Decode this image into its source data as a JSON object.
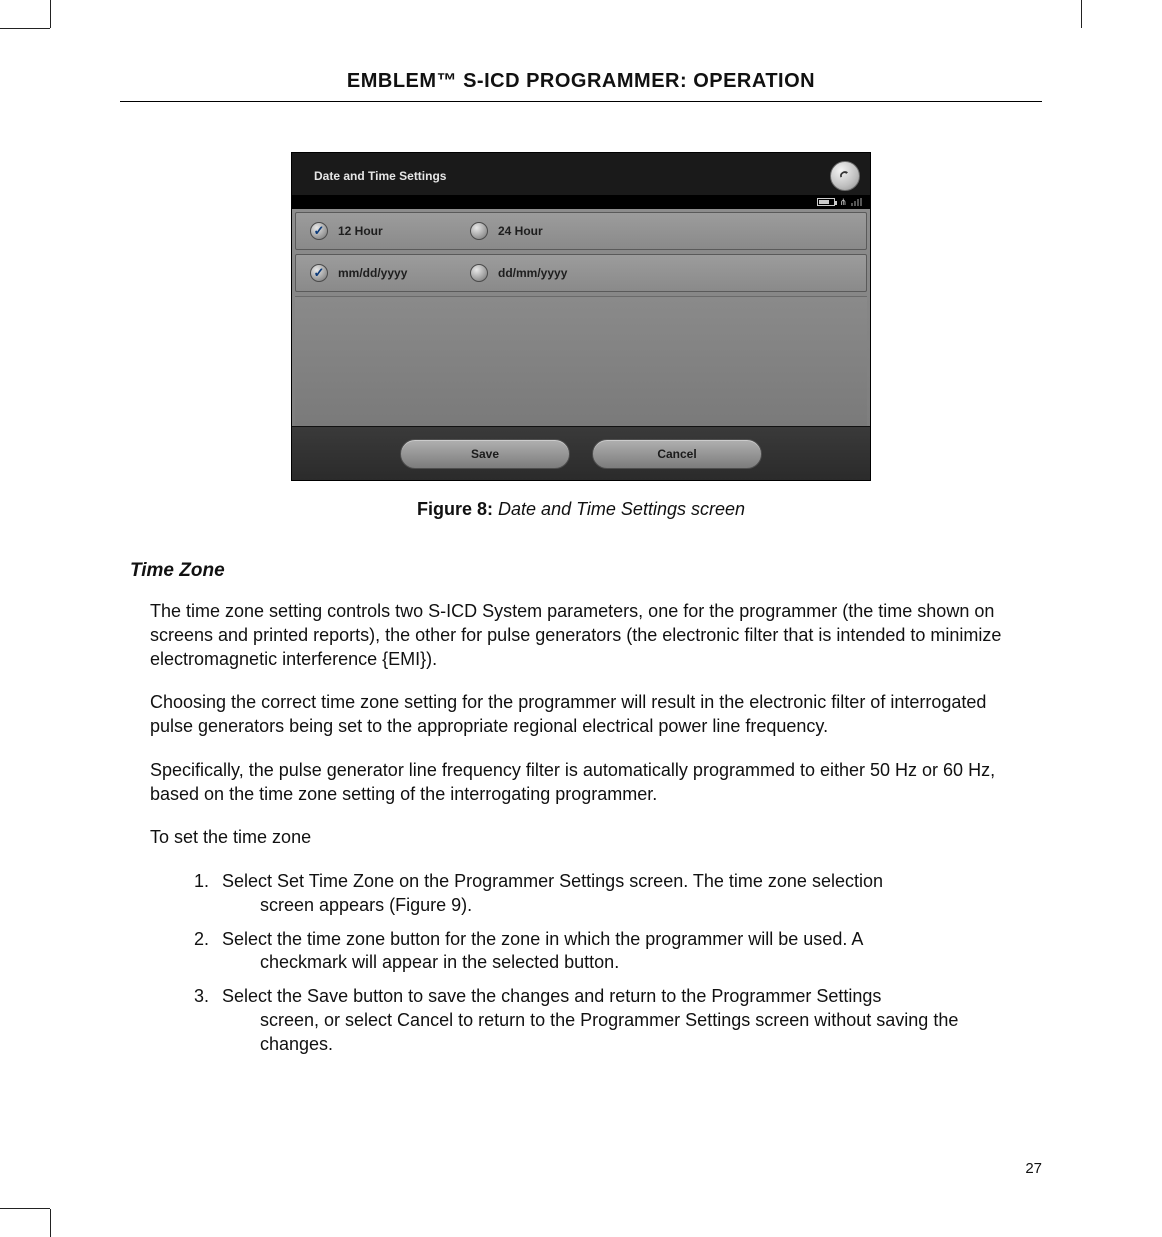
{
  "header": {
    "running_head": "EMBLEM™ S-ICD PROGRAMMER:  OPERATION"
  },
  "device": {
    "title": "Date and Time Settings",
    "row1_opt1": "12 Hour",
    "row1_opt2": "24 Hour",
    "row2_opt1": "mm/dd/yyyy",
    "row2_opt2": "dd/mm/yyyy",
    "save": "Save",
    "cancel": "Cancel"
  },
  "figure": {
    "label": "Figure 8:",
    "caption": "Date and Time Settings screen"
  },
  "section": {
    "heading": "Time Zone",
    "p1": "The time zone setting controls two S-ICD System parameters, one for the programmer (the time shown on screens and printed reports), the other for pulse generators (the electronic filter that is intended to minimize electromagnetic interference {EMI}).",
    "p2": "Choosing the correct time zone setting for the programmer will result in the electronic filter of interrogated pulse generators being set to the appropriate regional electrical power line frequency.",
    "p3": "Specifically, the pulse generator line frequency filter is automatically programmed to either 50 Hz or 60 Hz, based on the time zone setting of the interrogating programmer.",
    "p4": "To set the time zone",
    "step1_first": "Select Set Time Zone on the Programmer Settings screen. The time zone selection",
    "step1_cont": "screen appears (Figure 9).",
    "step2_first": "Select the time zone button for the zone in which the programmer will be used. A",
    "step2_cont": "checkmark will appear in the selected button.",
    "step3_first": "Select the Save button to save the changes and return to the Programmer Settings",
    "step3_cont": "screen, or select Cancel to return to the Programmer Settings screen without saving the changes."
  },
  "page_number": "27"
}
